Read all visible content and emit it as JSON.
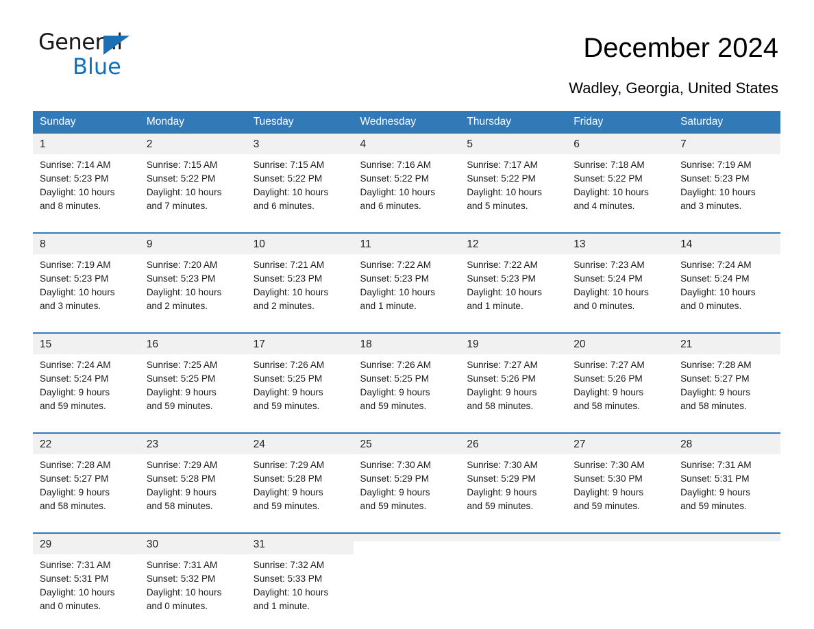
{
  "brand": {
    "name_part1": "General",
    "name_part2": "Blue",
    "triangle_color": "#1a6fb5",
    "blue_color": "#0f71ba"
  },
  "header": {
    "title": "December 2024",
    "location": "Wadley, Georgia, United States"
  },
  "theme": {
    "header_blue": "#3279b7",
    "row_divider": "#3279b7",
    "daynum_background": "#f1f1f1",
    "page_background": "#ffffff"
  },
  "weekday_headers": [
    "Sunday",
    "Monday",
    "Tuesday",
    "Wednesday",
    "Thursday",
    "Friday",
    "Saturday"
  ],
  "weeks": [
    [
      {
        "day": "1",
        "sunrise": "Sunrise: 7:14 AM",
        "sunset": "Sunset: 5:23 PM",
        "daylight_line1": "Daylight: 10 hours",
        "daylight_line2": "and 8 minutes."
      },
      {
        "day": "2",
        "sunrise": "Sunrise: 7:15 AM",
        "sunset": "Sunset: 5:22 PM",
        "daylight_line1": "Daylight: 10 hours",
        "daylight_line2": "and 7 minutes."
      },
      {
        "day": "3",
        "sunrise": "Sunrise: 7:15 AM",
        "sunset": "Sunset: 5:22 PM",
        "daylight_line1": "Daylight: 10 hours",
        "daylight_line2": "and 6 minutes."
      },
      {
        "day": "4",
        "sunrise": "Sunrise: 7:16 AM",
        "sunset": "Sunset: 5:22 PM",
        "daylight_line1": "Daylight: 10 hours",
        "daylight_line2": "and 6 minutes."
      },
      {
        "day": "5",
        "sunrise": "Sunrise: 7:17 AM",
        "sunset": "Sunset: 5:22 PM",
        "daylight_line1": "Daylight: 10 hours",
        "daylight_line2": "and 5 minutes."
      },
      {
        "day": "6",
        "sunrise": "Sunrise: 7:18 AM",
        "sunset": "Sunset: 5:22 PM",
        "daylight_line1": "Daylight: 10 hours",
        "daylight_line2": "and 4 minutes."
      },
      {
        "day": "7",
        "sunrise": "Sunrise: 7:19 AM",
        "sunset": "Sunset: 5:23 PM",
        "daylight_line1": "Daylight: 10 hours",
        "daylight_line2": "and 3 minutes."
      }
    ],
    [
      {
        "day": "8",
        "sunrise": "Sunrise: 7:19 AM",
        "sunset": "Sunset: 5:23 PM",
        "daylight_line1": "Daylight: 10 hours",
        "daylight_line2": "and 3 minutes."
      },
      {
        "day": "9",
        "sunrise": "Sunrise: 7:20 AM",
        "sunset": "Sunset: 5:23 PM",
        "daylight_line1": "Daylight: 10 hours",
        "daylight_line2": "and 2 minutes."
      },
      {
        "day": "10",
        "sunrise": "Sunrise: 7:21 AM",
        "sunset": "Sunset: 5:23 PM",
        "daylight_line1": "Daylight: 10 hours",
        "daylight_line2": "and 2 minutes."
      },
      {
        "day": "11",
        "sunrise": "Sunrise: 7:22 AM",
        "sunset": "Sunset: 5:23 PM",
        "daylight_line1": "Daylight: 10 hours",
        "daylight_line2": "and 1 minute."
      },
      {
        "day": "12",
        "sunrise": "Sunrise: 7:22 AM",
        "sunset": "Sunset: 5:23 PM",
        "daylight_line1": "Daylight: 10 hours",
        "daylight_line2": "and 1 minute."
      },
      {
        "day": "13",
        "sunrise": "Sunrise: 7:23 AM",
        "sunset": "Sunset: 5:24 PM",
        "daylight_line1": "Daylight: 10 hours",
        "daylight_line2": "and 0 minutes."
      },
      {
        "day": "14",
        "sunrise": "Sunrise: 7:24 AM",
        "sunset": "Sunset: 5:24 PM",
        "daylight_line1": "Daylight: 10 hours",
        "daylight_line2": "and 0 minutes."
      }
    ],
    [
      {
        "day": "15",
        "sunrise": "Sunrise: 7:24 AM",
        "sunset": "Sunset: 5:24 PM",
        "daylight_line1": "Daylight: 9 hours",
        "daylight_line2": "and 59 minutes."
      },
      {
        "day": "16",
        "sunrise": "Sunrise: 7:25 AM",
        "sunset": "Sunset: 5:25 PM",
        "daylight_line1": "Daylight: 9 hours",
        "daylight_line2": "and 59 minutes."
      },
      {
        "day": "17",
        "sunrise": "Sunrise: 7:26 AM",
        "sunset": "Sunset: 5:25 PM",
        "daylight_line1": "Daylight: 9 hours",
        "daylight_line2": "and 59 minutes."
      },
      {
        "day": "18",
        "sunrise": "Sunrise: 7:26 AM",
        "sunset": "Sunset: 5:25 PM",
        "daylight_line1": "Daylight: 9 hours",
        "daylight_line2": "and 59 minutes."
      },
      {
        "day": "19",
        "sunrise": "Sunrise: 7:27 AM",
        "sunset": "Sunset: 5:26 PM",
        "daylight_line1": "Daylight: 9 hours",
        "daylight_line2": "and 58 minutes."
      },
      {
        "day": "20",
        "sunrise": "Sunrise: 7:27 AM",
        "sunset": "Sunset: 5:26 PM",
        "daylight_line1": "Daylight: 9 hours",
        "daylight_line2": "and 58 minutes."
      },
      {
        "day": "21",
        "sunrise": "Sunrise: 7:28 AM",
        "sunset": "Sunset: 5:27 PM",
        "daylight_line1": "Daylight: 9 hours",
        "daylight_line2": "and 58 minutes."
      }
    ],
    [
      {
        "day": "22",
        "sunrise": "Sunrise: 7:28 AM",
        "sunset": "Sunset: 5:27 PM",
        "daylight_line1": "Daylight: 9 hours",
        "daylight_line2": "and 58 minutes."
      },
      {
        "day": "23",
        "sunrise": "Sunrise: 7:29 AM",
        "sunset": "Sunset: 5:28 PM",
        "daylight_line1": "Daylight: 9 hours",
        "daylight_line2": "and 58 minutes."
      },
      {
        "day": "24",
        "sunrise": "Sunrise: 7:29 AM",
        "sunset": "Sunset: 5:28 PM",
        "daylight_line1": "Daylight: 9 hours",
        "daylight_line2": "and 59 minutes."
      },
      {
        "day": "25",
        "sunrise": "Sunrise: 7:30 AM",
        "sunset": "Sunset: 5:29 PM",
        "daylight_line1": "Daylight: 9 hours",
        "daylight_line2": "and 59 minutes."
      },
      {
        "day": "26",
        "sunrise": "Sunrise: 7:30 AM",
        "sunset": "Sunset: 5:29 PM",
        "daylight_line1": "Daylight: 9 hours",
        "daylight_line2": "and 59 minutes."
      },
      {
        "day": "27",
        "sunrise": "Sunrise: 7:30 AM",
        "sunset": "Sunset: 5:30 PM",
        "daylight_line1": "Daylight: 9 hours",
        "daylight_line2": "and 59 minutes."
      },
      {
        "day": "28",
        "sunrise": "Sunrise: 7:31 AM",
        "sunset": "Sunset: 5:31 PM",
        "daylight_line1": "Daylight: 9 hours",
        "daylight_line2": "and 59 minutes."
      }
    ],
    [
      {
        "day": "29",
        "sunrise": "Sunrise: 7:31 AM",
        "sunset": "Sunset: 5:31 PM",
        "daylight_line1": "Daylight: 10 hours",
        "daylight_line2": "and 0 minutes."
      },
      {
        "day": "30",
        "sunrise": "Sunrise: 7:31 AM",
        "sunset": "Sunset: 5:32 PM",
        "daylight_line1": "Daylight: 10 hours",
        "daylight_line2": "and 0 minutes."
      },
      {
        "day": "31",
        "sunrise": "Sunrise: 7:32 AM",
        "sunset": "Sunset: 5:33 PM",
        "daylight_line1": "Daylight: 10 hours",
        "daylight_line2": "and 1 minute."
      },
      {
        "day": "",
        "sunrise": "",
        "sunset": "",
        "daylight_line1": "",
        "daylight_line2": ""
      },
      {
        "day": "",
        "sunrise": "",
        "sunset": "",
        "daylight_line1": "",
        "daylight_line2": ""
      },
      {
        "day": "",
        "sunrise": "",
        "sunset": "",
        "daylight_line1": "",
        "daylight_line2": ""
      },
      {
        "day": "",
        "sunrise": "",
        "sunset": "",
        "daylight_line1": "",
        "daylight_line2": ""
      }
    ]
  ]
}
